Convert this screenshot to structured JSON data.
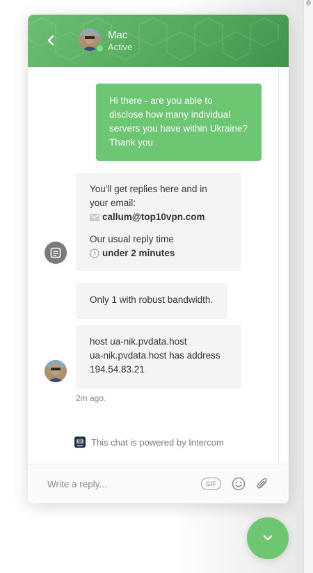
{
  "header": {
    "agent_name": "Mac",
    "agent_status": "Active"
  },
  "messages": {
    "user_message": "Hi there - are you able to disclose how many individual servers you have within Ukraine? Thank you",
    "bot": {
      "line1": "You'll get replies here and in",
      "line2": "your email:",
      "email": "callum@top10vpn.com",
      "reply_label": "Our usual reply time",
      "reply_time": "under 2 minutes"
    },
    "reply1": "Only 1 with robust bandwidth.",
    "reply2": {
      "line1": "host ua-nik.pvdata.host",
      "line2": "ua-nik.pvdata.host has address",
      "line3": "194.54.83.21"
    },
    "timestamp": "2m ago."
  },
  "footer": {
    "powered_by": "This chat is powered by Intercom"
  },
  "composer": {
    "placeholder": "Write a reply...",
    "gif_label": "GIF"
  },
  "icons": {
    "back": "chevron-left-icon",
    "bot": "message-square-icon",
    "email": "envelope-icon",
    "clock": "clock-icon",
    "intercom": "intercom-logo-icon",
    "emoji": "smiley-icon",
    "attach": "paperclip-icon",
    "launcher": "chevron-down-icon"
  },
  "colors": {
    "accent": "#6cc672",
    "header": "#52a85a",
    "admin_bubble": "#f4f4f4"
  }
}
